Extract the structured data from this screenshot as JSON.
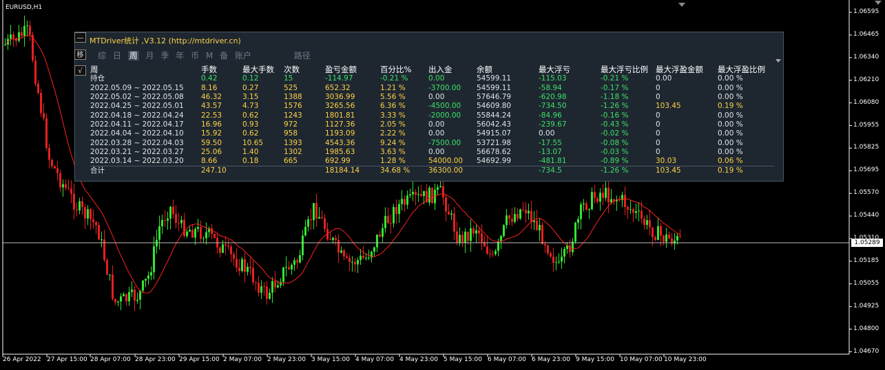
{
  "window": {
    "symbol": "EURUSD,H1"
  },
  "chart": {
    "current_price": "1.05289",
    "price_labels": [
      "1.06595",
      "1.06465",
      "1.06340",
      "1.06210",
      "1.06080",
      "1.05955",
      "1.05825",
      "1.05695",
      "1.05570",
      "1.05440",
      "1.05310",
      "1.05185",
      "1.05055",
      "1.04925",
      "1.04800",
      "1.04670"
    ],
    "time_labels": [
      "26 Apr 2022",
      "27 Apr 15:00",
      "28 Apr 07:00",
      "28 Apr 23:00",
      "29 Apr 15:00",
      "2 May 07:00",
      "2 May 23:00",
      "3 May 15:00",
      "4 May 07:00",
      "4 May 23:00",
      "5 May 15:00",
      "6 May 07:00",
      "6 May 23:00",
      "9 May 15:00",
      "10 May 07:00",
      "10 May 23:00"
    ],
    "colors": {
      "bull": "#32e632",
      "bear": "#e62020",
      "ma": "#ff2020",
      "background": "#000000"
    }
  },
  "panel": {
    "title": "MTDriver统计 ,V3.12 (http://mtdriver.cn)",
    "collapse_btn": "—",
    "move_btn": "移",
    "check_btn": "√",
    "tabs": [
      "综",
      "日",
      "周",
      "月",
      "季",
      "年",
      "币",
      "M",
      "备",
      "账户"
    ],
    "active_tab": "周",
    "path_tab": "路径",
    "headers": [
      "周",
      "手数",
      "最大手数",
      "次数",
      "盈亏金额",
      "百分比%",
      "出入金",
      "余额",
      "最大浮亏",
      "最大浮亏比例",
      "最大浮盈金额",
      "最大浮盈比例"
    ],
    "holding": {
      "label": "持仓",
      "cells": [
        "0.42",
        "0.12",
        "15",
        "-114.97",
        "-0.21 %",
        "0.00",
        "54599.11",
        "-115.03",
        "-0.21 %",
        "0.00",
        "0.00 %"
      ]
    },
    "rows": [
      [
        "2022.05.09 ~ 2022.05.15",
        "8.16",
        "0.27",
        "525",
        "652.32",
        "1.21 %",
        "-3700.00",
        "54599.11",
        "-58.94",
        "-0.17 %",
        "0",
        "0.00 %"
      ],
      [
        "2022.05.02 ~ 2022.05.08",
        "46.32",
        "3.15",
        "1388",
        "3036.99",
        "5.56 %",
        "0.00",
        "57646.79",
        "-620.98",
        "-1.18 %",
        "0",
        "0.00 %"
      ],
      [
        "2022.04.25 ~ 2022.05.01",
        "43.57",
        "4.73",
        "1576",
        "3265.56",
        "6.36 %",
        "-4500.00",
        "54609.80",
        "-734.50",
        "-1.26 %",
        "103.45",
        "0.19 %"
      ],
      [
        "2022.04.18 ~ 2022.04.24",
        "22.53",
        "0.62",
        "1243",
        "1801.81",
        "3.33 %",
        "-2000.00",
        "55844.24",
        "-84.96",
        "-0.16 %",
        "0",
        "0.00 %"
      ],
      [
        "2022.04.11 ~ 2022.04.17",
        "16.96",
        "0.93",
        "972",
        "1127.36",
        "2.05 %",
        "0.00",
        "56042.43",
        "-239.67",
        "-0.43 %",
        "0",
        "0.00 %"
      ],
      [
        "2022.04.04 ~ 2022.04.10",
        "15.92",
        "0.62",
        "958",
        "1193.09",
        "2.22 %",
        "0.00",
        "54915.07",
        "0.00",
        "-0.02 %",
        "0",
        "0.00 %"
      ],
      [
        "2022.03.28 ~ 2022.04.03",
        "59.50",
        "10.65",
        "1393",
        "4543.36",
        "9.24 %",
        "-7500.00",
        "53721.98",
        "-17.55",
        "-0.08 %",
        "0",
        "0.00 %"
      ],
      [
        "2022.03.21 ~ 2022.03.27",
        "25.06",
        "1.40",
        "1302",
        "1985.63",
        "3.63 %",
        "0.00",
        "56678.62",
        "-13.07",
        "-0.03 %",
        "0",
        "0.00 %"
      ],
      [
        "2022.03.14 ~ 2022.03.20",
        "8.66",
        "0.18",
        "665",
        "692.99",
        "1.28 %",
        "54000.00",
        "54692.99",
        "-481.81",
        "-0.89 %",
        "30.03",
        "0.06 %"
      ]
    ],
    "total": {
      "label": "合计",
      "cells": [
        "247.10",
        "",
        "",
        "18184.14",
        "34.68 %",
        "36300.00",
        "",
        "-734.5",
        "-1.26 %",
        "103.45",
        "0.19 %"
      ]
    }
  }
}
